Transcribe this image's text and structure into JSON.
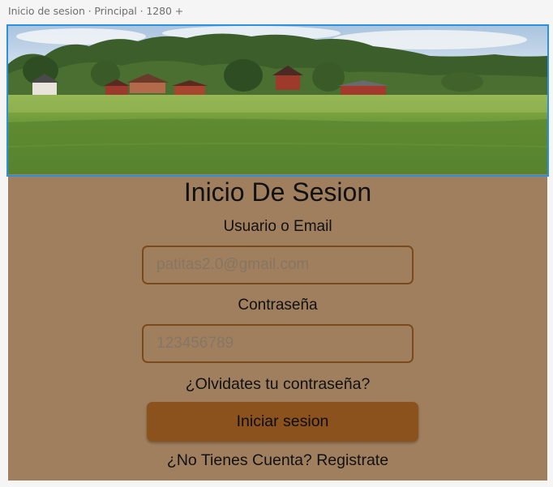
{
  "frame": {
    "label": "Inicio de sesion · Principal · 1280 +"
  },
  "hero": {
    "image_alt": "countryside landscape with farmhouses and green field"
  },
  "form": {
    "title": "Inicio De Sesion",
    "user_label": "Usuario o Email",
    "user_placeholder": "patitas2.0@gmail.com",
    "password_label": "Contraseña",
    "password_placeholder": "123456789",
    "forgot_link": "¿Olvidates tu contraseña?",
    "login_button": "Iniciar sesion",
    "register_link": "¿No Tienes Cuenta? Registrate"
  },
  "colors": {
    "panel": "#a07f5f",
    "button": "#8b521e",
    "input_border": "#7b4a1c",
    "selection": "#2d8fe0"
  }
}
